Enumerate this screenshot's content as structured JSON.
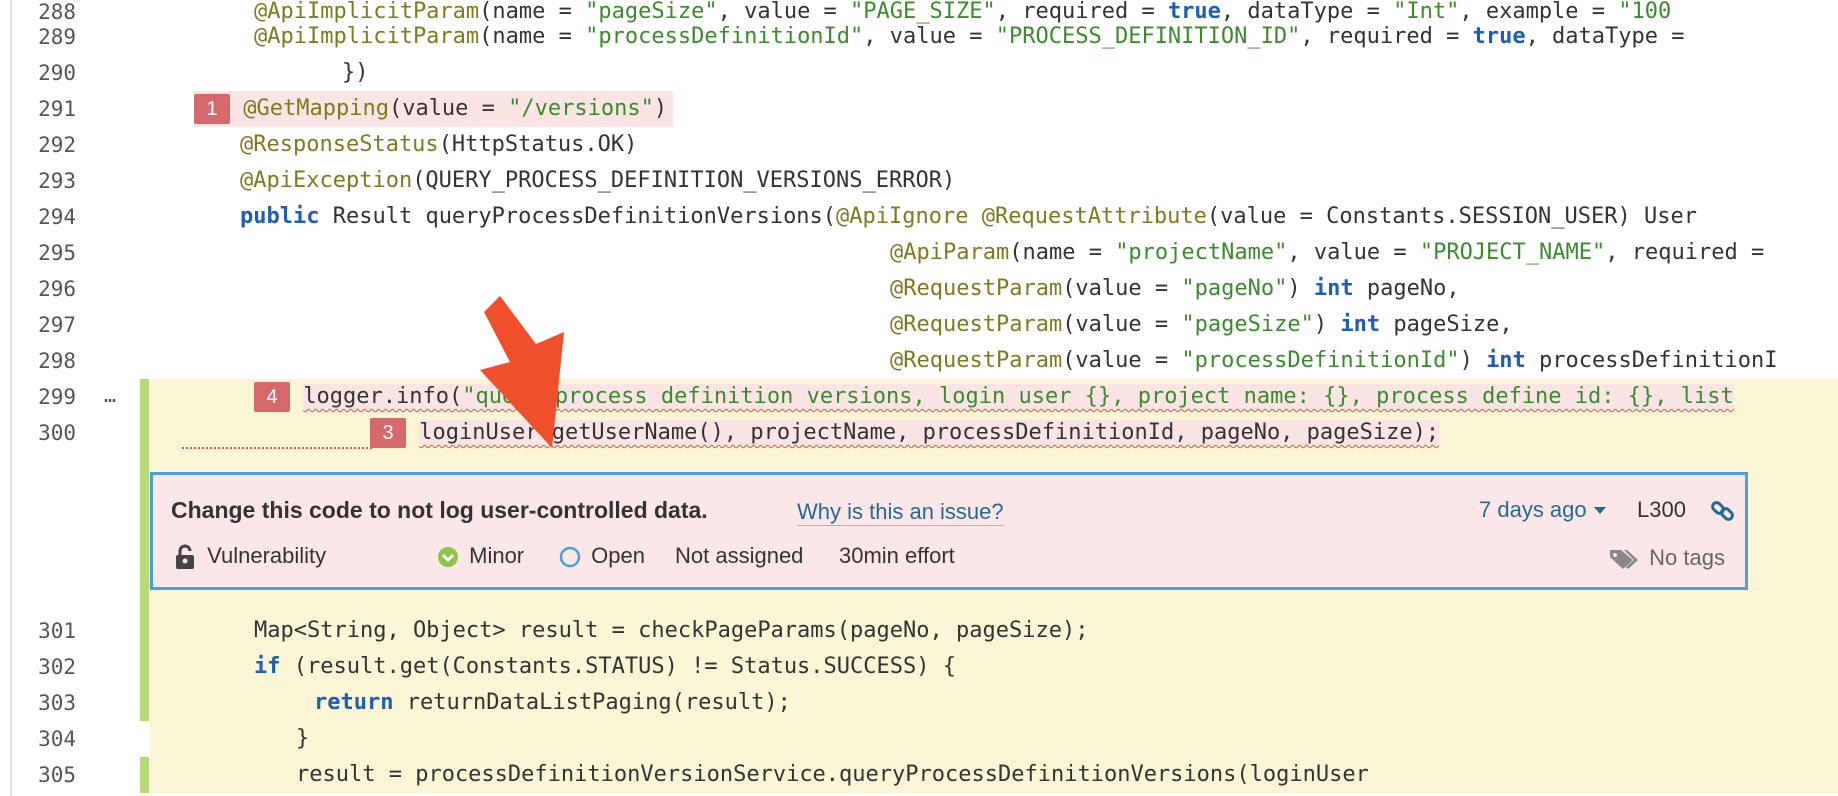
{
  "lines": {
    "l288": {
      "num": "288",
      "pre": "            ",
      "a1": "@ApiImplicitParam",
      "t1": "(name = ",
      "s1": "\"pageSize\"",
      "t2": ", value = ",
      "s2": "\"PAGE_SIZE\"",
      "t3": ", required = ",
      "k1": "true",
      "t4": ", dataType = ",
      "s3": "\"Int\"",
      "t5": ", example = ",
      "s4": "\"100"
    },
    "l289": {
      "num": "289",
      "pre": "            ",
      "a1": "@ApiImplicitParam",
      "t1": "(name = ",
      "s1": "\"processDefinitionId\"",
      "t2": ", value = ",
      "s2": "\"PROCESS_DEFINITION_ID\"",
      "t3": ", required = ",
      "k1": "true",
      "t4": ", dataType ="
    },
    "l290": {
      "num": "290",
      "code": "        })"
    },
    "l291": {
      "num": "291",
      "marker": "1",
      "a1": "@GetMapping",
      "t1": "(value = ",
      "s1": "\"/versions\"",
      "t2": ")"
    },
    "l292": {
      "num": "292",
      "a1": "@ResponseStatus",
      "t1": "(HttpStatus.OK)"
    },
    "l293": {
      "num": "293",
      "a1": "@ApiException",
      "t1": "(QUERY_PROCESS_DEFINITION_VERSIONS_ERROR)"
    },
    "l294": {
      "num": "294",
      "k1": "public",
      "t1": " Result queryProcessDefinitionVersions(",
      "a1": "@ApiIgnore",
      "t2": " ",
      "a2": "@RequestAttribute",
      "t3": "(value = Constants.SESSION_USER) User"
    },
    "l295": {
      "num": "295",
      "a1": "@ApiParam",
      "t1": "(name = ",
      "s1": "\"projectName\"",
      "t2": ", value = ",
      "s2": "\"PROJECT_NAME\"",
      "t3": ", required ="
    },
    "l296": {
      "num": "296",
      "a1": "@RequestParam",
      "t1": "(value = ",
      "s1": "\"pageNo\"",
      "t2": ") ",
      "k1": "int",
      "t3": " pageNo,"
    },
    "l297": {
      "num": "297",
      "a1": "@RequestParam",
      "t1": "(value = ",
      "s1": "\"pageSize\"",
      "t2": ") ",
      "k1": "int",
      "t3": " pageSize,"
    },
    "l298": {
      "num": "298",
      "a1": "@RequestParam",
      "t1": "(value = ",
      "s1": "\"processDefinitionId\"",
      "t2": ") ",
      "k1": "int",
      "t3": " processDefinitionI"
    },
    "l299": {
      "num": "299",
      "dots": "…",
      "marker": "4",
      "t1": "logger.info(",
      "s1": "\"query process definition versions, login user {}, project name: {}, process define id: {}, list"
    },
    "l300": {
      "num": "300",
      "marker": "3",
      "t1": "loginUser.getUserName(), projectName, processDefinitionId, pageNo, pageSize);"
    },
    "l301": {
      "num": "301",
      "t1": "Map<String, Object> result = checkPageParams(pageNo, pageSize);"
    },
    "l302": {
      "num": "302",
      "k1": "if",
      "t1": " (result.get(Constants.STATUS) != Status.SUCCESS) {"
    },
    "l303": {
      "num": "303",
      "k1": "return",
      "t1": " returnDataListPaging(result);"
    },
    "l304": {
      "num": "304",
      "t1": "}"
    },
    "l305": {
      "num": "305",
      "t1": "result = processDefinitionVersionService.queryProcessDefinitionVersions(loginUser"
    }
  },
  "issue": {
    "title": "Change this code to not log user-controlled data.",
    "why": "Why is this an issue?",
    "date": "7 days ago",
    "line": "L300",
    "type": "Vulnerability",
    "severity": "Minor",
    "status": "Open",
    "assignee": "Not assigned",
    "effort": "30min effort",
    "tags": "No tags"
  },
  "colors": {
    "highlight_bg": "#faf5d4",
    "changed_bar": "#b7d97a",
    "issue_bg": "#fbe7e7",
    "issue_border": "#4b9fd5",
    "marker_bg": "#d4686a",
    "arrow": "#ef4f2b",
    "keyword": "#1f5eb5",
    "annotation": "#7b7b20",
    "string": "#3b8a2e",
    "link": "#236a97"
  },
  "icons": [
    "lock-open-icon",
    "minor-severity-icon",
    "open-status-icon",
    "link-icon",
    "tag-icon",
    "caret-down-icon",
    "arrow-pointer"
  ]
}
